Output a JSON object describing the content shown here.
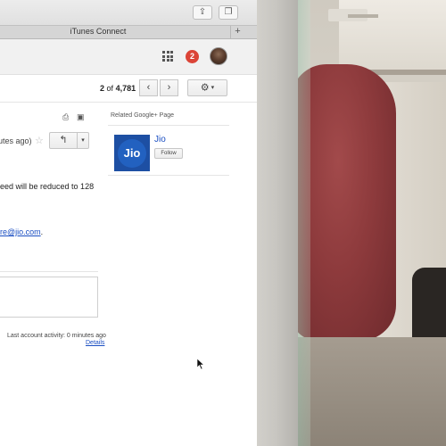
{
  "browser": {
    "tab_title": "iTunes Connect",
    "tab_add": "+",
    "share_icon": "share-icon",
    "tabs_icon": "tabs-overview-icon"
  },
  "gmail_header": {
    "apps_icon": "apps-grid-icon",
    "notification_count": "2",
    "notification_color": "#db4437"
  },
  "toolbar": {
    "pager_current": "2",
    "pager_of": "of",
    "pager_total": "4,781",
    "prev_label": "‹",
    "next_label": "›",
    "settings_icon": "⚙",
    "settings_caret": "▾"
  },
  "message": {
    "time_text": "utes ago)",
    "star_icon": "☆",
    "reply_icon": "↰",
    "more_icon": "▾",
    "body_line": "eed will be reduced to 128",
    "email_partial": "re@jio.com",
    "email_suffix": ".",
    "activity_text": "Last account activity: 0 minutes ago",
    "details_link": "Details"
  },
  "related": {
    "heading": "Related Google+ Page",
    "logo_text": "Jio",
    "name": "Jio",
    "follow_label": "Follow",
    "accent": "#1d4fa3"
  }
}
